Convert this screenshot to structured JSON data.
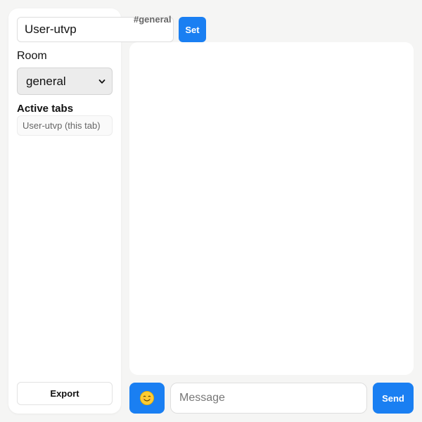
{
  "sidebar": {
    "username_value": "User-utvp",
    "room_label": "Room",
    "room_selected": "general",
    "active_tabs_title": "Active tabs",
    "active_tabs": [
      "User-utvp (this tab)"
    ],
    "export_label": "Export"
  },
  "header": {
    "channel": "#general",
    "set_label": "Set"
  },
  "composer": {
    "emoji": "smiling-face-icon",
    "message_placeholder": "Message",
    "send_label": "Send"
  },
  "colors": {
    "accent": "#1a7ff2",
    "background": "#f5f5f4",
    "panel": "#ffffff"
  }
}
